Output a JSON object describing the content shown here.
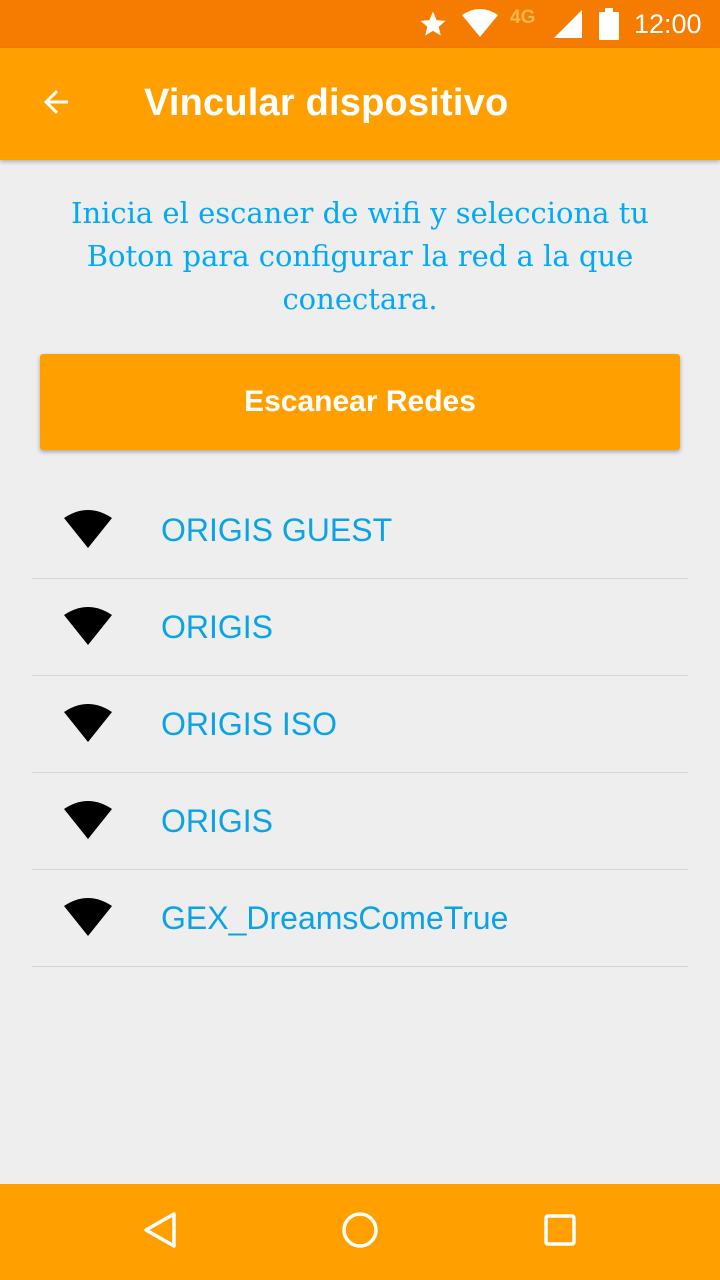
{
  "status_bar": {
    "network_type": "4G",
    "time": "12:00",
    "icons": [
      "star-icon",
      "wifi-icon",
      "signal-icon",
      "battery-icon"
    ]
  },
  "app_bar": {
    "title": "Vincular dispositivo",
    "back_icon": "arrow-back-icon"
  },
  "instructions": "Inicia el escaner de wifi y selecciona tu Boton para configurar la red a la que conectara.",
  "scan_button": {
    "label": "Escanear Redes"
  },
  "networks": [
    {
      "name": "ORIGIS GUEST",
      "icon": "wifi-icon"
    },
    {
      "name": "ORIGIS",
      "icon": "wifi-icon"
    },
    {
      "name": "ORIGIS ISO",
      "icon": "wifi-icon"
    },
    {
      "name": "ORIGIS",
      "icon": "wifi-icon"
    },
    {
      "name": "GEX_DreamsComeTrue",
      "icon": "wifi-icon"
    }
  ],
  "nav_bar": {
    "buttons": [
      "nav-back-icon",
      "nav-home-icon",
      "nav-recent-icon"
    ]
  },
  "colors": {
    "status_bar": "#f57c00",
    "primary": "#ffa000",
    "accent_text": "#03a9f4",
    "background": "#eeeeee"
  }
}
